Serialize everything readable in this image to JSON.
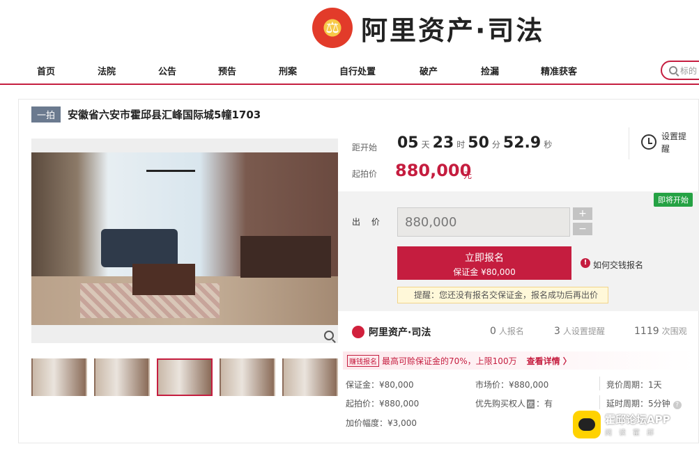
{
  "header": {
    "logo_text": "阿里资产·司法",
    "search_placeholder": "标的"
  },
  "nav": [
    {
      "label": "首页"
    },
    {
      "label": "法院"
    },
    {
      "label": "公告"
    },
    {
      "label": "预告"
    },
    {
      "label": "刑案"
    },
    {
      "label": "自行处置"
    },
    {
      "label": "破产"
    },
    {
      "label": "捡漏"
    },
    {
      "label": "精准获客"
    }
  ],
  "item": {
    "round_tag": "一拍",
    "title": "安徽省六安市霍邱县汇峰国际城5幢1703"
  },
  "countdown": {
    "label": "距开始",
    "days": "05",
    "days_unit": "天",
    "hours": "23",
    "hours_unit": "时",
    "minutes": "50",
    "minutes_unit": "分",
    "seconds": "52.9",
    "seconds_unit": "秒"
  },
  "start_price": {
    "label": "起拍价",
    "value": "880,000",
    "unit": "元"
  },
  "reminder": {
    "label": "设置提醒"
  },
  "bid": {
    "status_badge": "即将开始",
    "label": "出 价",
    "input_value": "880,000",
    "plus": "+",
    "minus": "−",
    "signup_label": "立即报名",
    "deposit_line": "保证金 ¥80,000",
    "how_icon": "!",
    "how_link": "如何交钱报名",
    "tip": "提醒：您还没有报名交保证金，报名成功后再出价"
  },
  "stats": {
    "brand": "阿里资产·司法",
    "signups_num": "0",
    "signups_label": "人报名",
    "reminders_num": "3",
    "reminders_label": "人设置提醒",
    "views_num": "1119",
    "views_label": "次围观"
  },
  "promo": {
    "tag": "赚钱报名",
    "text": "最高可赊保证金的70%，上限100万",
    "link": "查看详情 〉"
  },
  "info": {
    "deposit": "保证金：¥80,000",
    "market_price": "市场价：¥880,000",
    "cycle": "竞价周期：1天",
    "start_price": "起拍价：¥880,000",
    "priority_a": "优先购买权人",
    "priority_icon": "优",
    "priority_b": "：有",
    "delay": "延时周期：5分钟",
    "increment": "加价幅度：¥3,000"
  },
  "watermark": {
    "title": "霍邱论坛APP",
    "subtitle": "阅读霍邱"
  }
}
